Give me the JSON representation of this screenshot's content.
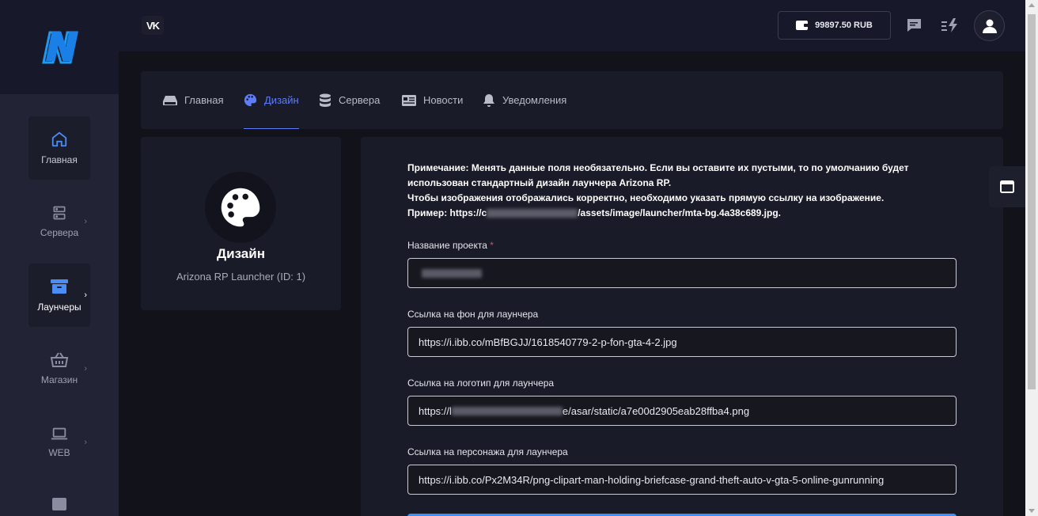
{
  "brand": {
    "logo_letter": "N"
  },
  "sidebar": {
    "items": [
      {
        "label": "Главная",
        "icon": "home-icon",
        "active": true
      },
      {
        "label": "Сервера",
        "icon": "server-icon",
        "chevron": "›"
      },
      {
        "label": "Лаунчеры",
        "icon": "archive-box-icon",
        "chevron": "›"
      },
      {
        "label": "Магазин",
        "icon": "basket-icon",
        "chevron": "›"
      },
      {
        "label": "WEB",
        "icon": "laptop-icon",
        "chevron": "›"
      }
    ]
  },
  "topbar": {
    "vk_label": "VK",
    "balance": "99897.50 RUB"
  },
  "tabs": [
    {
      "label": "Главная",
      "icon": "hdd-icon"
    },
    {
      "label": "Дизайн",
      "icon": "palette-icon",
      "active": true
    },
    {
      "label": "Сервера",
      "icon": "database-icon"
    },
    {
      "label": "Новости",
      "icon": "newspaper-icon"
    },
    {
      "label": "Уведомления",
      "icon": "bell-icon"
    }
  ],
  "design_card": {
    "title": "Дизайн",
    "subtitle": "Arizona RP Launcher (ID: 1)"
  },
  "form": {
    "note_line1": "Примечание: Менять данные поля необязательно. Если вы оставите их пустыми, то по умолчанию будет использован стандартный дизайн лаунчера Arizona RP.",
    "note_line2": "Чтобы изображения отображались корректно, необходимо указать прямую ссылку на изображение.",
    "note_example_prefix": "Пример: https://c",
    "note_example_suffix": "/assets/image/launcher/mta-bg.4a38c689.jpg.",
    "fields": [
      {
        "label": "Название проекта",
        "required_mark": "*",
        "value": ""
      },
      {
        "label": "Ссылка на фон для лаунчера",
        "value": "https://i.ibb.co/mBfBGJJ/1618540779-2-p-fon-gta-4-2.jpg"
      },
      {
        "label": "Ссылка на логотип для лаунчера",
        "value_prefix": "https://l",
        "value_suffix": "e/asar/static/a7e00d2905eab28ffba4.png"
      },
      {
        "label": "Ссылка на персонажа для лаунчера",
        "value": "https://i.ibb.co/Px2M34R/png-clipart-man-holding-briefcase-grand-theft-auto-v-gta-5-online-gunrunning"
      }
    ]
  },
  "colors": {
    "accent": "#5f7cf8",
    "required": "#e8475b",
    "logo_blue": "#1d9bf0"
  }
}
